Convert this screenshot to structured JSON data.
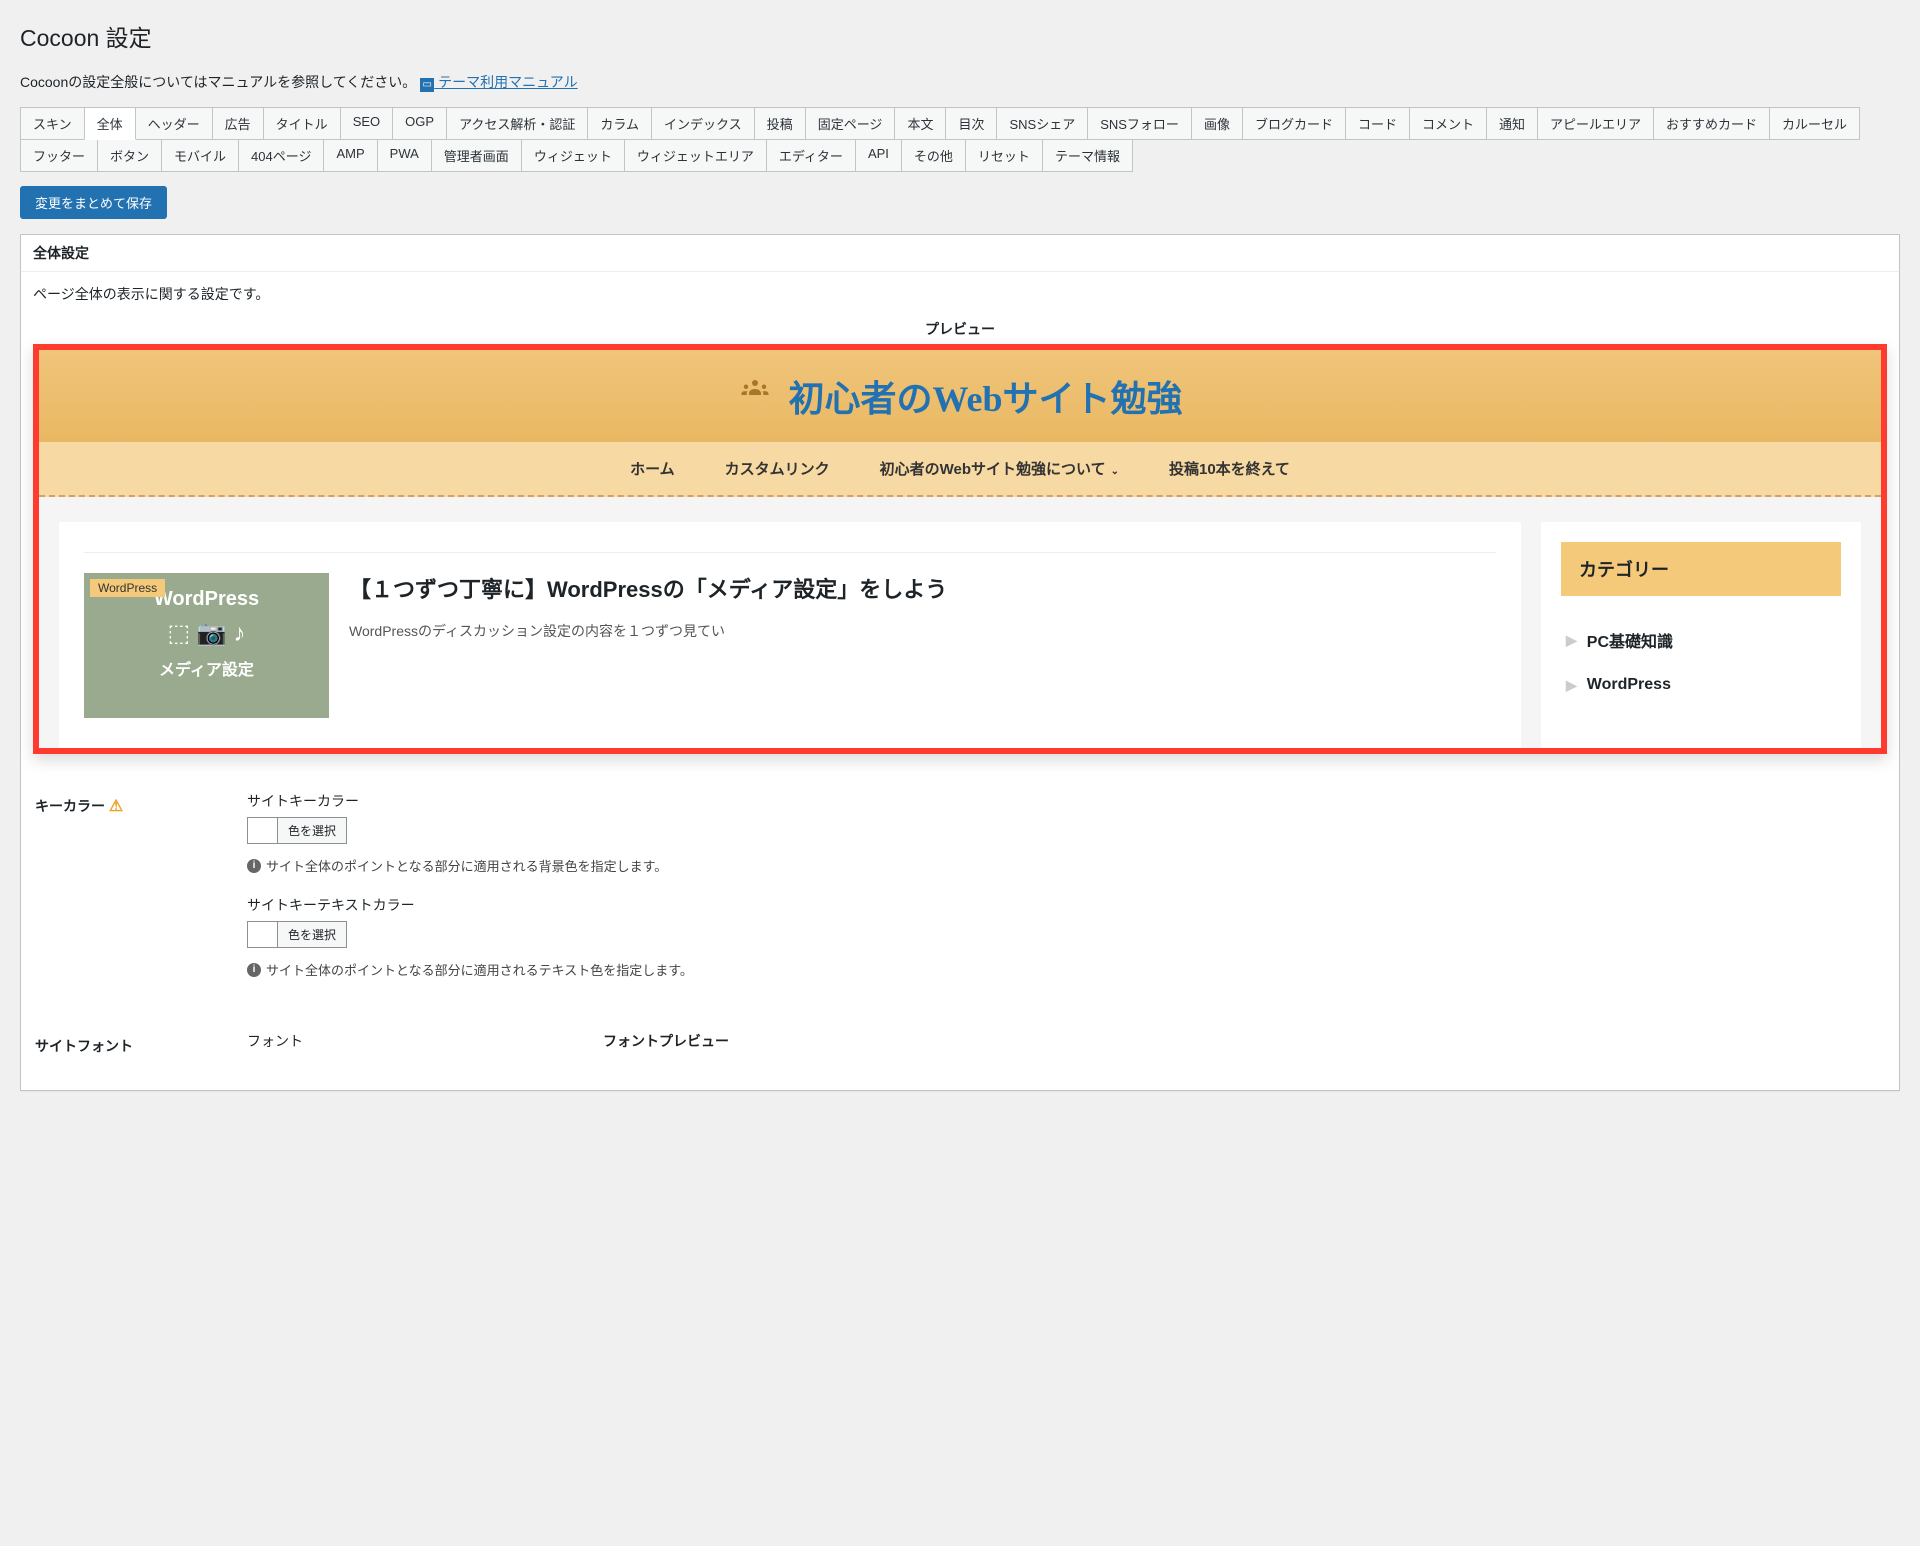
{
  "page": {
    "title": "Cocoon 設定",
    "description": "Cocoonの設定全般についてはマニュアルを参照してください。",
    "manual_link": "テーマ利用マニュアル"
  },
  "tabs": [
    "スキン",
    "全体",
    "ヘッダー",
    "広告",
    "タイトル",
    "SEO",
    "OGP",
    "アクセス解析・認証",
    "カラム",
    "インデックス",
    "投稿",
    "固定ページ",
    "本文",
    "目次",
    "SNSシェア",
    "SNSフォロー",
    "画像",
    "ブログカード",
    "コード",
    "コメント",
    "通知",
    "アピールエリア",
    "おすすめカード",
    "カルーセル",
    "フッター",
    "ボタン",
    "モバイル",
    "404ページ",
    "AMP",
    "PWA",
    "管理者画面",
    "ウィジェット",
    "ウィジェットエリア",
    "エディター",
    "API",
    "その他",
    "リセット",
    "テーマ情報"
  ],
  "active_tab_index": 1,
  "save_button": "変更をまとめて保存",
  "section": {
    "heading": "全体設定",
    "description": "ページ全体の表示に関する設定です。",
    "preview_label": "プレビュー"
  },
  "preview": {
    "site_title": "初心者のWebサイト勉強",
    "nav": [
      "ホーム",
      "カスタムリンク",
      "初心者のWebサイト勉強について",
      "投稿10本を終えて"
    ],
    "nav_has_sub": [
      false,
      false,
      true,
      false
    ],
    "entry": {
      "badge": "WordPress",
      "thumb_title": "WordPress",
      "thumb_sub": "メディア設定",
      "title": "【１つずつ丁寧に】WordPressの「メディア設定」をしよう",
      "excerpt": "WordPressのディスカッション設定の内容を１つずつ見てい"
    },
    "sidebar": {
      "heading": "カテゴリー",
      "items": [
        "PC基礎知識",
        "WordPress"
      ]
    }
  },
  "settings": {
    "keycolor": {
      "label": "キーカラー",
      "field1_label": "サイトキーカラー",
      "field2_label": "サイトキーテキストカラー",
      "color_btn": "色を選択",
      "hint1": "サイト全体のポイントとなる部分に適用される背景色を指定します。",
      "hint2": "サイト全体のポイントとなる部分に適用されるテキスト色を指定します。"
    },
    "font": {
      "label": "サイトフォント",
      "field_label": "フォント",
      "preview_label": "フォントプレビュー"
    }
  }
}
